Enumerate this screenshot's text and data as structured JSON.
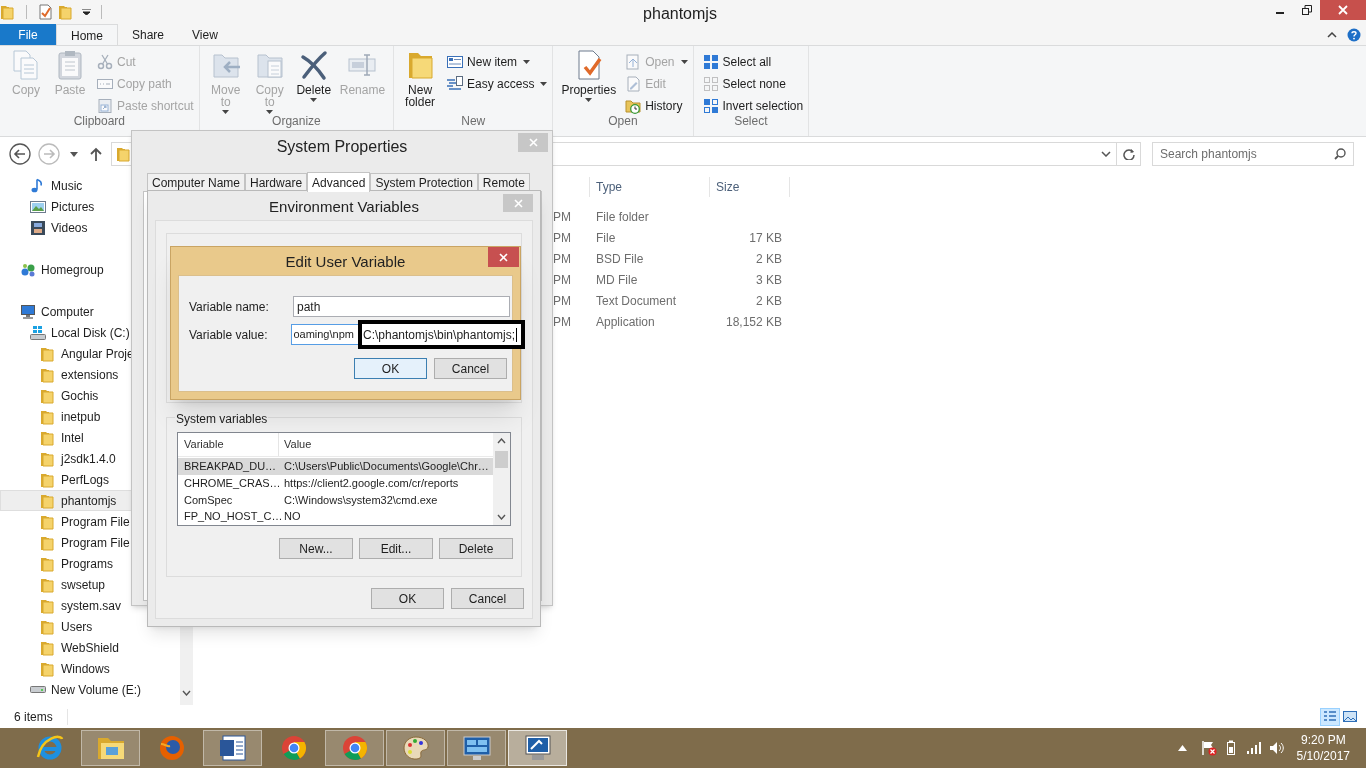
{
  "window": {
    "title": "phantomjs"
  },
  "ribbon_tabs": [
    {
      "label": "File",
      "kind": "file",
      "selected": false
    },
    {
      "label": "Home",
      "kind": "tab",
      "selected": true
    },
    {
      "label": "Share",
      "kind": "tab",
      "selected": false
    },
    {
      "label": "View",
      "kind": "tab",
      "selected": false
    }
  ],
  "ribbon_groups": [
    {
      "label": "Clipboard",
      "items": [
        {
          "label": "Copy",
          "kind": "large",
          "disabled": true,
          "dropdown": false
        },
        {
          "label": "Paste",
          "kind": "large",
          "disabled": true,
          "dropdown": false
        },
        {
          "label": "Cut",
          "kind": "small",
          "disabled": true,
          "dropdown": false
        },
        {
          "label": "Copy path",
          "kind": "small",
          "disabled": true,
          "dropdown": false
        },
        {
          "label": "Paste shortcut",
          "kind": "small",
          "disabled": true,
          "dropdown": false
        }
      ]
    },
    {
      "label": "Organize",
      "items": [
        {
          "label": "Move to",
          "kind": "large",
          "disabled": true,
          "dropdown": true
        },
        {
          "label": "Copy to",
          "kind": "large",
          "disabled": true,
          "dropdown": true
        },
        {
          "label": "Delete",
          "kind": "large",
          "disabled": false,
          "dropdown": true
        },
        {
          "label": "Rename",
          "kind": "large",
          "disabled": true,
          "dropdown": false
        }
      ]
    },
    {
      "label": "New",
      "items": [
        {
          "label": "New folder",
          "kind": "large",
          "disabled": false,
          "dropdown": false
        },
        {
          "label": "New item",
          "kind": "small",
          "disabled": false,
          "dropdown": true
        },
        {
          "label": "Easy access",
          "kind": "small",
          "disabled": false,
          "dropdown": true
        }
      ]
    },
    {
      "label": "Open",
      "items": [
        {
          "label": "Properties",
          "kind": "large",
          "disabled": false,
          "dropdown": true
        },
        {
          "label": "Open",
          "kind": "small",
          "disabled": true,
          "dropdown": true
        },
        {
          "label": "Edit",
          "kind": "small",
          "disabled": true,
          "dropdown": false
        },
        {
          "label": "History",
          "kind": "small",
          "disabled": false,
          "dropdown": false
        }
      ]
    },
    {
      "label": "Select",
      "items": [
        {
          "label": "Select all",
          "kind": "small",
          "disabled": false,
          "dropdown": false
        },
        {
          "label": "Select none",
          "kind": "small",
          "disabled": false,
          "dropdown": false
        },
        {
          "label": "Invert selection",
          "kind": "small",
          "disabled": false,
          "dropdown": false
        }
      ]
    }
  ],
  "search": {
    "placeholder": "Search phantomjs"
  },
  "nav_pane": {
    "library_items": [
      {
        "label": "Music",
        "kind": "music",
        "selected": false
      },
      {
        "label": "Pictures",
        "kind": "pictures",
        "selected": false
      },
      {
        "label": "Videos",
        "kind": "videos",
        "selected": false
      }
    ],
    "items": [
      {
        "label": "Homegroup",
        "kind": "homegroup",
        "selected": false
      },
      {
        "label": "Computer",
        "kind": "computer",
        "selected": false,
        "children": [
          {
            "label": "Local Disk (C:)",
            "kind": "system-drive",
            "selected": false,
            "children": [
              {
                "label": "Angular Proje",
                "kind": "folder",
                "selected": false
              },
              {
                "label": "extensions",
                "kind": "folder",
                "selected": false
              },
              {
                "label": "Gochis",
                "kind": "folder",
                "selected": false
              },
              {
                "label": "inetpub",
                "kind": "folder",
                "selected": false
              },
              {
                "label": "Intel",
                "kind": "folder",
                "selected": false
              },
              {
                "label": "j2sdk1.4.0",
                "kind": "folder",
                "selected": false
              },
              {
                "label": "PerfLogs",
                "kind": "folder",
                "selected": false
              },
              {
                "label": "phantomjs",
                "kind": "folder",
                "selected": true
              },
              {
                "label": "Program File",
                "kind": "folder",
                "selected": false
              },
              {
                "label": "Program File",
                "kind": "folder",
                "selected": false
              },
              {
                "label": "Programs",
                "kind": "folder",
                "selected": false
              },
              {
                "label": "swsetup",
                "kind": "folder",
                "selected": false
              },
              {
                "label": "system.sav",
                "kind": "folder",
                "selected": false
              },
              {
                "label": "Users",
                "kind": "folder",
                "selected": false
              },
              {
                "label": "WebShield",
                "kind": "folder",
                "selected": false
              },
              {
                "label": "Windows",
                "kind": "folder",
                "selected": false
              }
            ]
          },
          {
            "label": "New Volume (E:)",
            "kind": "drive",
            "selected": false
          }
        ]
      }
    ]
  },
  "file_list": {
    "columns": [
      "Type",
      "Size"
    ],
    "rows": [
      {
        "column_1": "PM",
        "type": "File folder"
      },
      {
        "column_1": "PM",
        "type": "File",
        "size": "17 KB"
      },
      {
        "column_1": "PM",
        "type": "BSD File",
        "size": "2 KB"
      },
      {
        "column_1": "PM",
        "type": "MD File",
        "size": "3 KB"
      },
      {
        "column_1": "PM",
        "type": "Text Document",
        "size": "2 KB"
      },
      {
        "column_1": "PM",
        "type": "Application",
        "size": "18,152 KB"
      }
    ]
  },
  "status_bar": {
    "text": "6 items",
    "view_buttons": [
      {
        "selected": true
      },
      {
        "selected": false
      }
    ]
  },
  "system_properties": {
    "title": "System Properties",
    "tabs": [
      {
        "label": "Computer Name",
        "selected": false
      },
      {
        "label": "Hardware",
        "selected": false
      },
      {
        "label": "Advanced",
        "selected": true
      },
      {
        "label": "System Protection",
        "selected": false
      },
      {
        "label": "Remote",
        "selected": false
      }
    ]
  },
  "environment_variables": {
    "title": "Environment Variables",
    "system_variables": {
      "label": "System variables",
      "columns": [
        "Variable",
        "Value"
      ],
      "rows": [
        {
          "variable": "BREAKPAD_DU…",
          "value": "C:\\Users\\Public\\Documents\\Google\\Chr…",
          "selected": true
        },
        {
          "variable": "CHROME_CRAS…",
          "value": "https://client2.google.com/cr/reports",
          "selected": false
        },
        {
          "variable": "ComSpec",
          "value": "C:\\Windows\\system32\\cmd.exe",
          "selected": false
        },
        {
          "variable": "FP_NO_HOST_C…",
          "value": "NO",
          "selected": false
        }
      ]
    },
    "list_buttons": [
      "New...",
      "Edit...",
      "Delete"
    ],
    "dialog_buttons": [
      "OK",
      "Cancel"
    ]
  },
  "edit_user_variable": {
    "title": "Edit User Variable",
    "name_field": {
      "label": "Variable name:",
      "value": "path"
    },
    "value_field": {
      "label": "Variable value:",
      "value": "oaming\\npm",
      "highlighted": "C:\\phantomjs\\bin\\phantomjs;"
    },
    "buttons": [
      {
        "label": "OK",
        "default": true
      },
      {
        "label": "Cancel",
        "default": false
      }
    ]
  },
  "taskbar": {
    "apps": [
      {
        "kind": "ie",
        "running": false,
        "selected": false
      },
      {
        "kind": "explorer",
        "running": true,
        "selected": false
      },
      {
        "kind": "firefox",
        "running": false,
        "selected": false
      },
      {
        "kind": "word",
        "running": true,
        "selected": false
      },
      {
        "kind": "chrome",
        "running": false,
        "selected": false
      },
      {
        "kind": "chrome",
        "running": true,
        "selected": false
      },
      {
        "kind": "paint",
        "running": true,
        "selected": false
      },
      {
        "kind": "control-panel",
        "running": true,
        "selected": false
      },
      {
        "kind": "remote",
        "running": true,
        "selected": true
      }
    ],
    "clock": {
      "time": "9:20 PM",
      "date": "5/10/2017"
    }
  }
}
